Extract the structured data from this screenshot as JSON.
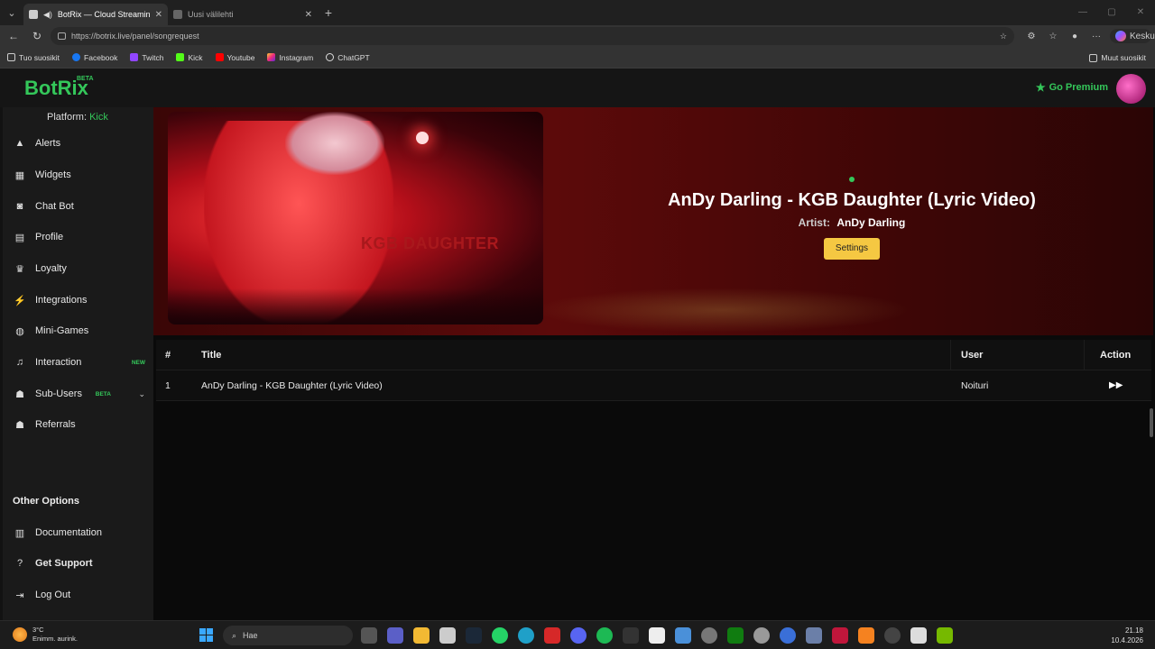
{
  "browser": {
    "tabs": [
      {
        "label": "BotRix — Cloud Streaming Bot",
        "active": true
      },
      {
        "label": "Uusi välilehti",
        "active": false
      }
    ],
    "url": "https://botrix.live/panel/songrequest",
    "copilot_label": "Keskustelu",
    "bookmarks": [
      "Tuo suosikit",
      "Facebook",
      "Twitch",
      "Kick",
      "Youtube",
      "Instagram",
      "ChatGPT"
    ],
    "other_bookmarks": "Muut suosikit"
  },
  "app": {
    "brand": "BotRix",
    "brand_badge": "BETA",
    "premium_label": "Go Premium",
    "platform_label": "Platform:",
    "platform_value": "Kick",
    "nav": [
      {
        "label": "Alerts",
        "icon": "warning-icon"
      },
      {
        "label": "Widgets",
        "icon": "grid-icon"
      },
      {
        "label": "Chat Bot",
        "icon": "robot-icon"
      },
      {
        "label": "Profile",
        "icon": "id-card-icon"
      },
      {
        "label": "Loyalty",
        "icon": "trophy-icon"
      },
      {
        "label": "Integrations",
        "icon": "plug-icon"
      },
      {
        "label": "Mini-Games",
        "icon": "gamepad-icon"
      },
      {
        "label": "Interaction",
        "icon": "music-note-icon",
        "tag": "NEW"
      },
      {
        "label": "Sub-Users",
        "icon": "users-icon",
        "tag": "BETA"
      },
      {
        "label": "Referrals",
        "icon": "user-group-icon"
      }
    ],
    "other_options_title": "Other Options",
    "other_nav": [
      {
        "label": "Documentation",
        "icon": "book-icon"
      },
      {
        "label": "Get Support",
        "icon": "question-icon"
      },
      {
        "label": "Log Out",
        "icon": "logout-icon"
      }
    ],
    "now_playing": {
      "title": "AnDy Darling - KGB Daughter (Lyric Video)",
      "artist_label": "Artist:",
      "artist": "AnDy Darling",
      "settings_label": "Settings",
      "thumb_text": "KGB DAUGHTER"
    },
    "queue": {
      "headers": {
        "num": "#",
        "title": "Title",
        "user": "User",
        "action": "Action"
      },
      "rows": [
        {
          "num": "1",
          "title": "AnDy Darling - KGB Daughter (Lyric Video)",
          "user": "Noituri"
        }
      ]
    },
    "colors": {
      "accent": "#34c75a",
      "settings_button": "#f5c842"
    }
  },
  "taskbar": {
    "weather_temp": "3°C",
    "weather_desc": "Enimm. aurink.",
    "search_placeholder": "Hae",
    "time": "21.18",
    "date": "10.4.2026"
  }
}
